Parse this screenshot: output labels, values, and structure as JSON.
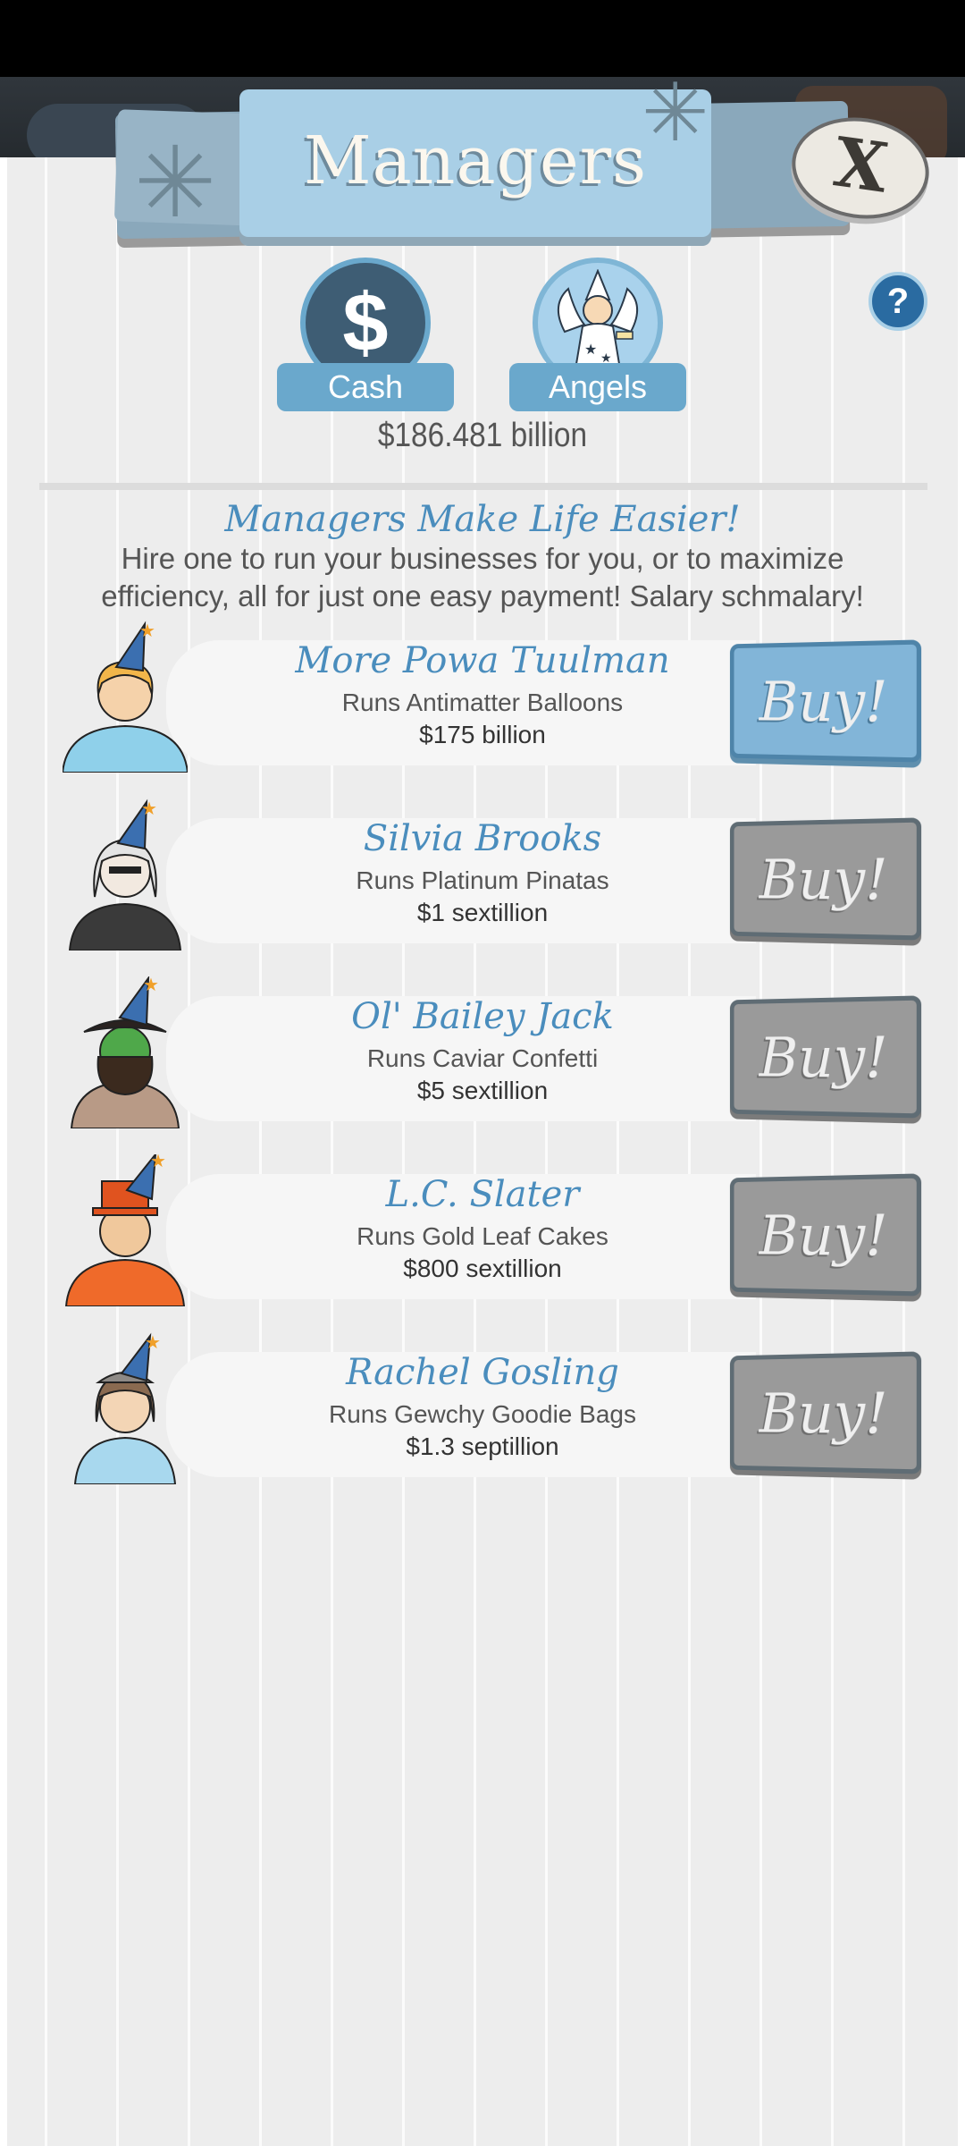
{
  "header": {
    "title": "Managers",
    "close_label": "X",
    "help_label": "?"
  },
  "tabs": [
    {
      "label": "Cash",
      "icon": "dollar-icon",
      "symbol": "$"
    },
    {
      "label": "Angels",
      "icon": "angel-icon"
    }
  ],
  "balance": "$186.481 billion",
  "promo": {
    "title": "Managers Make Life Easier!",
    "text": "Hire one to run your businesses for you, or to maximize efficiency, all for just one easy payment! Salary schmalary!"
  },
  "managers": [
    {
      "name": "More Powa Tuulman",
      "runs": "Runs Antimatter Balloons",
      "price": "$175 billion",
      "buy_label": "Buy!",
      "affordable": true,
      "hair": "#f2b64a",
      "outfit": "#8fd0ea"
    },
    {
      "name": "Silvia Brooks",
      "runs": "Runs Platinum Pinatas",
      "price": "$1 sextillion",
      "buy_label": "Buy!",
      "affordable": false,
      "hair": "#e4e4e4",
      "outfit": "#3a3a3a"
    },
    {
      "name": "Ol' Bailey Jack",
      "runs": "Runs Caviar Confetti",
      "price": "$5 sextillion",
      "buy_label": "Buy!",
      "affordable": false,
      "hair": "#3b2a1e",
      "outfit": "#b89a86"
    },
    {
      "name": "L.C. Slater",
      "runs": "Runs Gold Leaf Cakes",
      "price": "$800 sextillion",
      "buy_label": "Buy!",
      "affordable": false,
      "hair": "#e0531f",
      "outfit": "#ef6a2a"
    },
    {
      "name": "Rachel Gosling",
      "runs": "Runs Gewchy Goodie Bags",
      "price": "$1.3 septillion",
      "buy_label": "Buy!",
      "affordable": false,
      "hair": "#8a6a50",
      "outfit": "#a8d8ee"
    }
  ]
}
